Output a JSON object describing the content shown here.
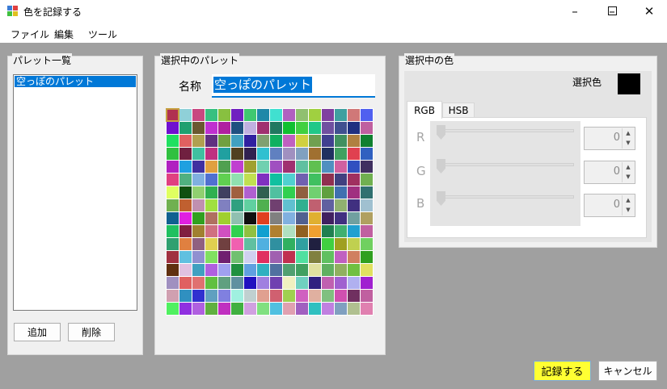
{
  "window": {
    "title": "色を記録する",
    "minimize_icon": "minimize-icon",
    "maximize_icon": "maximize-icon",
    "close_icon": "close-icon"
  },
  "menu": [
    "ファイル",
    "編集",
    "ツール"
  ],
  "palette_list": {
    "title": "パレット一覧",
    "items": [
      "空っぽのパレット"
    ],
    "selected_index": 0,
    "add_label": "追加",
    "delete_label": "削除"
  },
  "selected_palette": {
    "title": "選択中のパレット",
    "name_label": "名称",
    "name_value": "空っぽのパレット",
    "swatches": [
      "#b03050",
      "#8fd0d8",
      "#c84880",
      "#38c080",
      "#88c040",
      "#7020c0",
      "#40c870",
      "#2088a8",
      "#40e0d0",
      "#b060c0",
      "#90c070",
      "#a0d040",
      "#8040a0",
      "#40a0a0",
      "#d07878",
      "#5060f0",
      "#40b8a0",
      "#7010d0",
      "#20a070",
      "#6a5830",
      "#c030d0",
      "#b020a0",
      "#205080",
      "#c0b0e0",
      "#a03070",
      "#207860",
      "#10c030",
      "#40d040",
      "#20c888",
      "#7050a0",
      "#405090",
      "#203080",
      "#c060a0",
      "#c0c040",
      "#20e060",
      "#e06060",
      "#b0a050",
      "#603080",
      "#70a040",
      "#40a0c0",
      "#3020a0",
      "#80a070",
      "#10b060",
      "#c060c0",
      "#d0d040",
      "#70a050",
      "#404090",
      "#409060",
      "#b08040",
      "#108030",
      "#900040",
      "#30c040",
      "#702040",
      "#40c0a0",
      "#c03080",
      "#20a0a0",
      "#504020",
      "#302050",
      "#30c0d0",
      "#6080c0",
      "#a090c0",
      "#80a0c0",
      "#a07030",
      "#203060",
      "#40a060",
      "#e04050",
      "#3060c0",
      "#b06080",
      "#b020c0",
      "#20a0e0",
      "#4030a0",
      "#e0a040",
      "#50a050",
      "#c040d0",
      "#a0a030",
      "#70d0b0",
      "#a050c0",
      "#a03070",
      "#60c0a0",
      "#60c050",
      "#5090c0",
      "#d060a0",
      "#3050c0",
      "#403060",
      "#e0e040",
      "#e04080",
      "#50b080",
      "#80b0e0",
      "#5070d0",
      "#60d050",
      "#90e0b0",
      "#c0e050",
      "#8030c0",
      "#10c0a0",
      "#50d0d0",
      "#7060b0",
      "#40c060",
      "#903050",
      "#404080",
      "#a03060",
      "#70b050",
      "#c0a050",
      "#e0ff60",
      "#105010",
      "#90d070",
      "#30b050",
      "#404060",
      "#a06040",
      "#b060d0",
      "#306050",
      "#50c0a0",
      "#30d050",
      "#906040",
      "#70d070",
      "#60a040",
      "#4070b0",
      "#a03080",
      "#307070",
      "#a07040",
      "#70b050",
      "#c06030",
      "#c090b0",
      "#a0e040",
      "#8080c0",
      "#30a080",
      "#60d0a0",
      "#50b050",
      "#704070",
      "#60c0d0",
      "#30b090",
      "#c06070",
      "#6060a0",
      "#90b070",
      "#403080",
      "#a0c0d0",
      "#d080a0",
      "#106090",
      "#e020e0",
      "#30a020",
      "#b07060",
      "#a0d030",
      "#90c0b0",
      "#101010",
      "#e04020",
      "#808080",
      "#80b0e0",
      "#506090",
      "#e0b030",
      "#402060",
      "#403080",
      "#70a0a0",
      "#b0a060",
      "#50c080",
      "#20c060",
      "#802040",
      "#a08030",
      "#d07080",
      "#d050c0",
      "#30d050",
      "#90c040",
      "#10a0d0",
      "#b08030",
      "#b0e0c0",
      "#906020",
      "#f0a030",
      "#208050",
      "#40b070",
      "#20a0d0",
      "#c060a0",
      "#e03030",
      "#30a070",
      "#e08040",
      "#906080",
      "#e0d050",
      "#704040",
      "#f060b0",
      "#60c0a0",
      "#50b0e0",
      "#3090a0",
      "#30b060",
      "#30a0a0",
      "#202040",
      "#40d040",
      "#a0a020",
      "#c0d050",
      "#70d060",
      "#7a6010",
      "#a03040",
      "#60c0e0",
      "#9090d0",
      "#80e060",
      "#702070",
      "#70c070",
      "#d0d0f0",
      "#e03060",
      "#a060b0",
      "#c03050",
      "#50e0a0",
      "#808040",
      "#60c060",
      "#c060c0",
      "#d08060",
      "#30a020",
      "#20c040",
      "#603010",
      "#e0c0e0",
      "#40a0c0",
      "#b060e0",
      "#a0a0f0",
      "#209040",
      "#60a0e0",
      "#30b0c0",
      "#5070a0",
      "#50a070",
      "#40a060",
      "#e0e0a0",
      "#60b060",
      "#90b060",
      "#70c040",
      "#e0e060",
      "#30a030",
      "#a090c0",
      "#e06060",
      "#e07070",
      "#60c040",
      "#60a080",
      "#6090a0",
      "#2010c0",
      "#a080e0",
      "#7040b0",
      "#f0f0c0",
      "#70d0c0",
      "#302080",
      "#c060b0",
      "#a060d0",
      "#b0b0f0",
      "#a020d0",
      "#9020c0",
      "#d0a0b0",
      "#3090c0",
      "#3030d0",
      "#60a0c0",
      "#8080e0",
      "#a0f0e0",
      "#c0d0d0",
      "#e0a090",
      "#d06070",
      "#a0d050",
      "#d060c0",
      "#e0b0a0",
      "#80c080",
      "#d050b0",
      "#703060",
      "#c060a0",
      "#b0f0c0",
      "#50f060",
      "#9030e0",
      "#b060e0",
      "#60b040",
      "#c030c0",
      "#40b040",
      "#d0a0e0",
      "#80e080",
      "#50c0e0",
      "#e0a0b0",
      "#a060c0",
      "#30c0c0",
      "#c080e0",
      "#80a0c0",
      "#b0c090",
      "#e080b0",
      "#d040e0",
      "#6080f0",
      "#a0d0d0",
      "#d0d060",
      "#f08080",
      "#503080",
      "#40a0f0",
      "#608070",
      "#a0e0a0",
      "#c0c0f0",
      "#2020d0",
      "#d0e0d0",
      "#90b0c0",
      "#e0c0a0",
      "#f0f080",
      "#a0d080",
      "#80f060",
      "#c0a0f0"
    ]
  },
  "selected_color": {
    "title": "選択中の色",
    "label": "選択色",
    "color": "#000000",
    "tabs": [
      "RGB",
      "HSB"
    ],
    "active_tab": "RGB",
    "channels": [
      {
        "label": "R",
        "value": "0"
      },
      {
        "label": "G",
        "value": "0"
      },
      {
        "label": "B",
        "value": "0"
      }
    ]
  },
  "footer": {
    "save_label": "記録する",
    "cancel_label": "キャンセル"
  }
}
